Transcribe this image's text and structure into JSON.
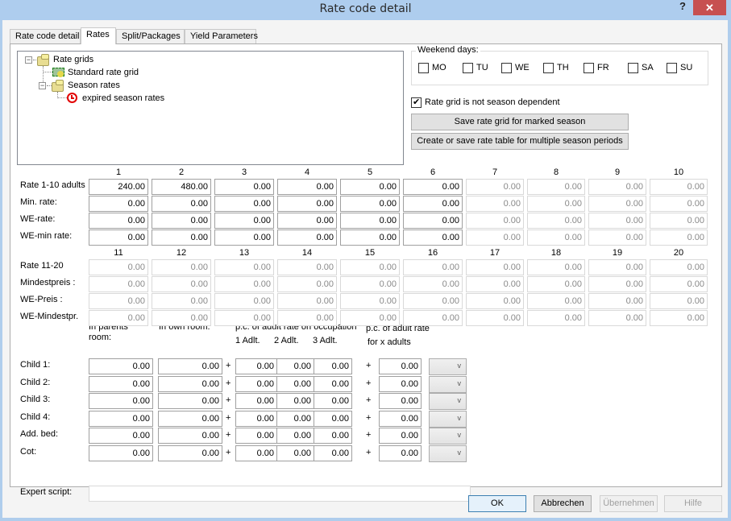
{
  "window": {
    "title": "Rate code detail",
    "help_label": "?",
    "close_label": "✕"
  },
  "tabs": [
    {
      "label": "Rate code detail",
      "active": false
    },
    {
      "label": "Rates",
      "active": true
    },
    {
      "label": "Split/Packages",
      "active": false
    },
    {
      "label": "Yield Parameters",
      "active": false
    }
  ],
  "tree": {
    "items": [
      {
        "label": "Rate grids",
        "icon": "folder-icon",
        "expander": "−"
      },
      {
        "label": "Standard rate grid",
        "icon": "rate-grid-icon"
      },
      {
        "label": "Season rates",
        "icon": "folder-icon",
        "expander": "−"
      },
      {
        "label": "expired season rates",
        "icon": "expired-clock-icon"
      }
    ]
  },
  "weekend": {
    "legend": "Weekend days:",
    "days": [
      {
        "label": "MO",
        "checked": false
      },
      {
        "label": "TU",
        "checked": false
      },
      {
        "label": "WE",
        "checked": false
      },
      {
        "label": "TH",
        "checked": false
      },
      {
        "label": "FR",
        "checked": false
      },
      {
        "label": "SA",
        "checked": false
      },
      {
        "label": "SU",
        "checked": false
      }
    ]
  },
  "season_independent": {
    "label": "Rate grid is not season dependent",
    "checked": true
  },
  "buttons": {
    "save_marked": "Save rate grid for marked season",
    "create_multi": "Create or save rate table for multiple season periods",
    "ok": "OK",
    "cancel": "Abbrechen",
    "apply": "Übernehmen",
    "help": "Hilfe"
  },
  "grid1": {
    "columns": [
      "1",
      "2",
      "3",
      "4",
      "5",
      "6",
      "7",
      "8",
      "9",
      "10"
    ],
    "rows": [
      {
        "label": "Rate 1-10 adults",
        "values": [
          "240.00",
          "480.00",
          "0.00",
          "0.00",
          "0.00",
          "0.00",
          "0.00",
          "0.00",
          "0.00",
          "0.00"
        ]
      },
      {
        "label": "Min. rate:",
        "values": [
          "0.00",
          "0.00",
          "0.00",
          "0.00",
          "0.00",
          "0.00",
          "0.00",
          "0.00",
          "0.00",
          "0.00"
        ]
      },
      {
        "label": "WE-rate:",
        "values": [
          "0.00",
          "0.00",
          "0.00",
          "0.00",
          "0.00",
          "0.00",
          "0.00",
          "0.00",
          "0.00",
          "0.00"
        ]
      },
      {
        "label": "WE-min rate:",
        "values": [
          "0.00",
          "0.00",
          "0.00",
          "0.00",
          "0.00",
          "0.00",
          "0.00",
          "0.00",
          "0.00",
          "0.00"
        ]
      }
    ],
    "enabled_columns": 6
  },
  "grid2": {
    "columns": [
      "11",
      "12",
      "13",
      "14",
      "15",
      "16",
      "17",
      "18",
      "19",
      "20"
    ],
    "rows": [
      {
        "label": "Rate 11-20",
        "values": [
          "0.00",
          "0.00",
          "0.00",
          "0.00",
          "0.00",
          "0.00",
          "0.00",
          "0.00",
          "0.00",
          "0.00"
        ]
      },
      {
        "label": "Mindestpreis :",
        "values": [
          "0.00",
          "0.00",
          "0.00",
          "0.00",
          "0.00",
          "0.00",
          "0.00",
          "0.00",
          "0.00",
          "0.00"
        ]
      },
      {
        "label": "WE-Preis :",
        "values": [
          "0.00",
          "0.00",
          "0.00",
          "0.00",
          "0.00",
          "0.00",
          "0.00",
          "0.00",
          "0.00",
          "0.00"
        ]
      },
      {
        "label": "WE-Mindestpr.",
        "values": [
          "0.00",
          "0.00",
          "0.00",
          "0.00",
          "0.00",
          "0.00",
          "0.00",
          "0.00",
          "0.00",
          "0.00"
        ]
      }
    ],
    "enabled_columns": 0
  },
  "children": {
    "headers": {
      "parents_room_1": "In parents",
      "parents_room_2": "room:",
      "own_room": "In own room:",
      "pc_occupation": "p.c. of adult rate on occupation",
      "adlt1": "1 Adlt.",
      "adlt2": "2 Adlt.",
      "adlt3": "3 Adlt.",
      "pc_x_1": "p.c. of adult rate",
      "pc_x_2": "for x adults"
    },
    "plus": "+",
    "rows": [
      {
        "label": "Child 1:",
        "parents": "0.00",
        "own": "0.00",
        "a1": "0.00",
        "a2": "0.00",
        "a3": "0.00",
        "x": "0.00",
        "select": ""
      },
      {
        "label": "Child 2:",
        "parents": "0.00",
        "own": "0.00",
        "a1": "0.00",
        "a2": "0.00",
        "a3": "0.00",
        "x": "0.00",
        "select": ""
      },
      {
        "label": "Child 3:",
        "parents": "0.00",
        "own": "0.00",
        "a1": "0.00",
        "a2": "0.00",
        "a3": "0.00",
        "x": "0.00",
        "select": ""
      },
      {
        "label": "Child 4:",
        "parents": "0.00",
        "own": "0.00",
        "a1": "0.00",
        "a2": "0.00",
        "a3": "0.00",
        "x": "0.00",
        "select": ""
      },
      {
        "label": "Add. bed:",
        "parents": "0.00",
        "own": "0.00",
        "a1": "0.00",
        "a2": "0.00",
        "a3": "0.00",
        "x": "0.00",
        "select": ""
      },
      {
        "label": "Cot:",
        "parents": "0.00",
        "own": "0.00",
        "a1": "0.00",
        "a2": "0.00",
        "a3": "0.00",
        "x": "0.00",
        "select": ""
      }
    ],
    "expert_label": "Expert script:",
    "expert_value": ""
  }
}
